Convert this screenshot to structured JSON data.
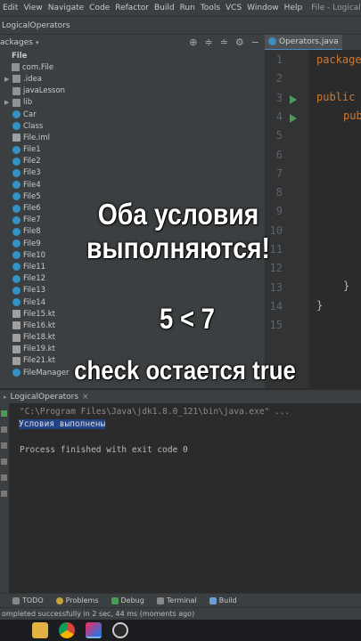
{
  "menu": {
    "items": [
      "Edit",
      "View",
      "Navigate",
      "Code",
      "Refactor",
      "Build",
      "Run",
      "Tools",
      "VCS",
      "Window",
      "Help"
    ],
    "window_title": "File - LogicalOperator"
  },
  "titlebar": {
    "project": "LogicalOperators"
  },
  "project_toolbar": {
    "label": "ackages"
  },
  "editor_tab": {
    "label": "Operators.java"
  },
  "tree": [
    {
      "label": "File",
      "type": "header",
      "indent": 0,
      "arrow": ""
    },
    {
      "label": "com.File",
      "type": "folder",
      "indent": 0,
      "arrow": ""
    },
    {
      "label": ".idea",
      "type": "folder",
      "indent": 1,
      "arrow": "▶"
    },
    {
      "label": "javaLesson",
      "type": "folder",
      "indent": 1,
      "arrow": ""
    },
    {
      "label": "lib",
      "type": "folder",
      "indent": 1,
      "arrow": "▶"
    },
    {
      "label": "Car",
      "type": "java",
      "indent": 1,
      "arrow": ""
    },
    {
      "label": "Class",
      "type": "java",
      "indent": 1,
      "arrow": ""
    },
    {
      "label": "File.iml",
      "type": "iml",
      "indent": 1,
      "arrow": ""
    },
    {
      "label": "File1",
      "type": "java",
      "indent": 1,
      "arrow": ""
    },
    {
      "label": "File2",
      "type": "java",
      "indent": 1,
      "arrow": ""
    },
    {
      "label": "File3",
      "type": "java",
      "indent": 1,
      "arrow": ""
    },
    {
      "label": "File4",
      "type": "java",
      "indent": 1,
      "arrow": ""
    },
    {
      "label": "File5",
      "type": "java",
      "indent": 1,
      "arrow": ""
    },
    {
      "label": "File6",
      "type": "java",
      "indent": 1,
      "arrow": ""
    },
    {
      "label": "File7",
      "type": "java",
      "indent": 1,
      "arrow": ""
    },
    {
      "label": "File8",
      "type": "java",
      "indent": 1,
      "arrow": ""
    },
    {
      "label": "File9",
      "type": "java",
      "indent": 1,
      "arrow": ""
    },
    {
      "label": "File10",
      "type": "java",
      "indent": 1,
      "arrow": ""
    },
    {
      "label": "File11",
      "type": "java",
      "indent": 1,
      "arrow": ""
    },
    {
      "label": "File12",
      "type": "java",
      "indent": 1,
      "arrow": ""
    },
    {
      "label": "File13",
      "type": "java",
      "indent": 1,
      "arrow": ""
    },
    {
      "label": "File14",
      "type": "java",
      "indent": 1,
      "arrow": ""
    },
    {
      "label": "File15.kt",
      "type": "kt",
      "indent": 1,
      "arrow": ""
    },
    {
      "label": "File16.kt",
      "type": "kt",
      "indent": 1,
      "arrow": ""
    },
    {
      "label": "File18.kt",
      "type": "kt",
      "indent": 1,
      "arrow": ""
    },
    {
      "label": "File19.kt",
      "type": "kt",
      "indent": 1,
      "arrow": ""
    },
    {
      "label": "File21.kt",
      "type": "kt",
      "indent": 1,
      "arrow": ""
    },
    {
      "label": "FileManager",
      "type": "java",
      "indent": 1,
      "arrow": ""
    }
  ],
  "gutter": {
    "line_numbers": [
      "1",
      "2",
      "3",
      "4",
      "5",
      "6",
      "7",
      "8",
      "9",
      "10",
      "11",
      "12",
      "13",
      "14",
      "15"
    ]
  },
  "code": {
    "line1": "package",
    "line3": "public",
    "line4": "pub",
    "line13": "}",
    "line14": "}"
  },
  "captions": {
    "line1": "Оба условия",
    "line2": "выполняются!",
    "expr": "5 < 7",
    "result": "check остается true"
  },
  "run_panel": {
    "tab": "LogicalOperators",
    "command": "\"C:\\Program Files\\Java\\jdk1.8.0_121\\bin\\java.exe\" ...",
    "output": "Условия выполнены",
    "exit": "Process finished with exit code 0"
  },
  "bottom_tools": [
    "TODO",
    "Problems",
    "Debug",
    "Terminal",
    "Build"
  ],
  "status": "ompleted successfully in 2 sec, 44 ms (moments ago)",
  "colors": {
    "accent": "#4a88c7",
    "selection": "#214283",
    "run_green": "#499c54",
    "keyword": "#cc7832"
  }
}
